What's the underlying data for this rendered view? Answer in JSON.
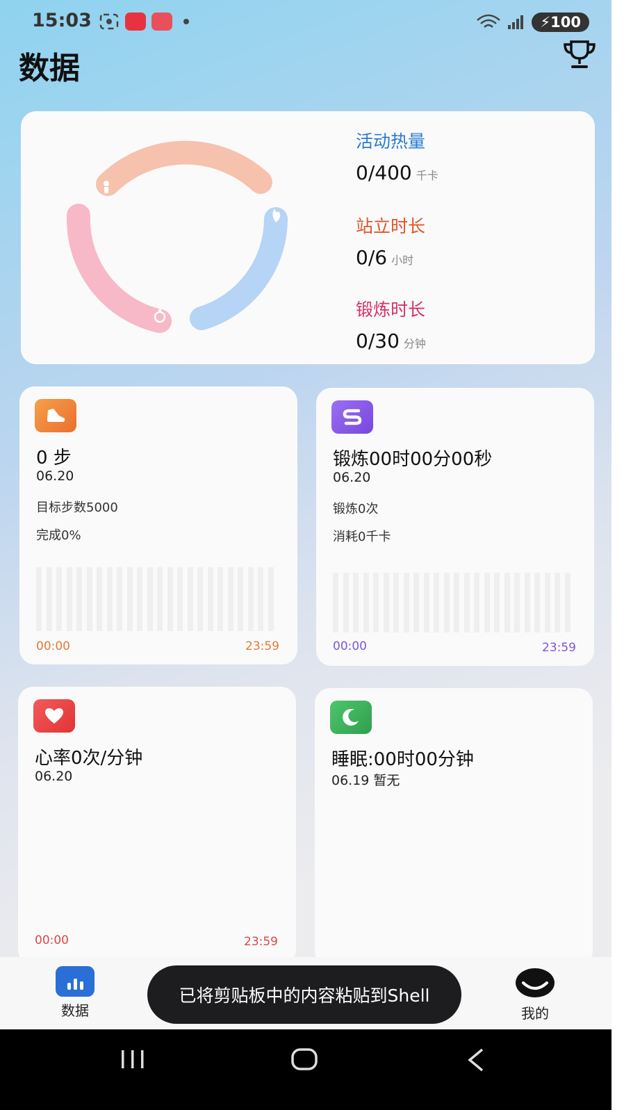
{
  "status_bar": {
    "time": "15:03",
    "battery": "100"
  },
  "page_title": "数据",
  "ring_card": {
    "rings": [
      {
        "label": "活动热量",
        "value": "0/400",
        "unit": "千卡",
        "color": "#2a7bd1"
      },
      {
        "label": "站立时长",
        "value": "0/6",
        "unit": "小时",
        "color": "#e0562a"
      },
      {
        "label": "锻炼时长",
        "value": "0/30",
        "unit": "分钟",
        "color": "#d6336c"
      }
    ]
  },
  "tiles": {
    "steps": {
      "title": "0 步",
      "date": "06.20",
      "line1": "目标步数5000",
      "line2": "完成0%",
      "start": "00:00",
      "end": "23:59",
      "accent": "#e27a35"
    },
    "exercise": {
      "title": "锻炼00时00分00秒",
      "date": "06.20",
      "line1": "锻炼0次",
      "line2": "消耗0千卡",
      "start": "00:00",
      "end": "23:59",
      "accent": "#7b57e0"
    },
    "heart": {
      "title": "心率0次/分钟",
      "date": "06.20",
      "start": "00:00",
      "end": "23:59",
      "accent": "#e04646"
    },
    "sleep": {
      "title": "睡眠:00时00分钟",
      "date": "06.19 暂无",
      "accent": "#33b05a"
    }
  },
  "bottom_nav": {
    "data_label": "数据",
    "mine_label": "我的"
  },
  "toast": "已将剪贴板中的内容粘贴到Shell"
}
